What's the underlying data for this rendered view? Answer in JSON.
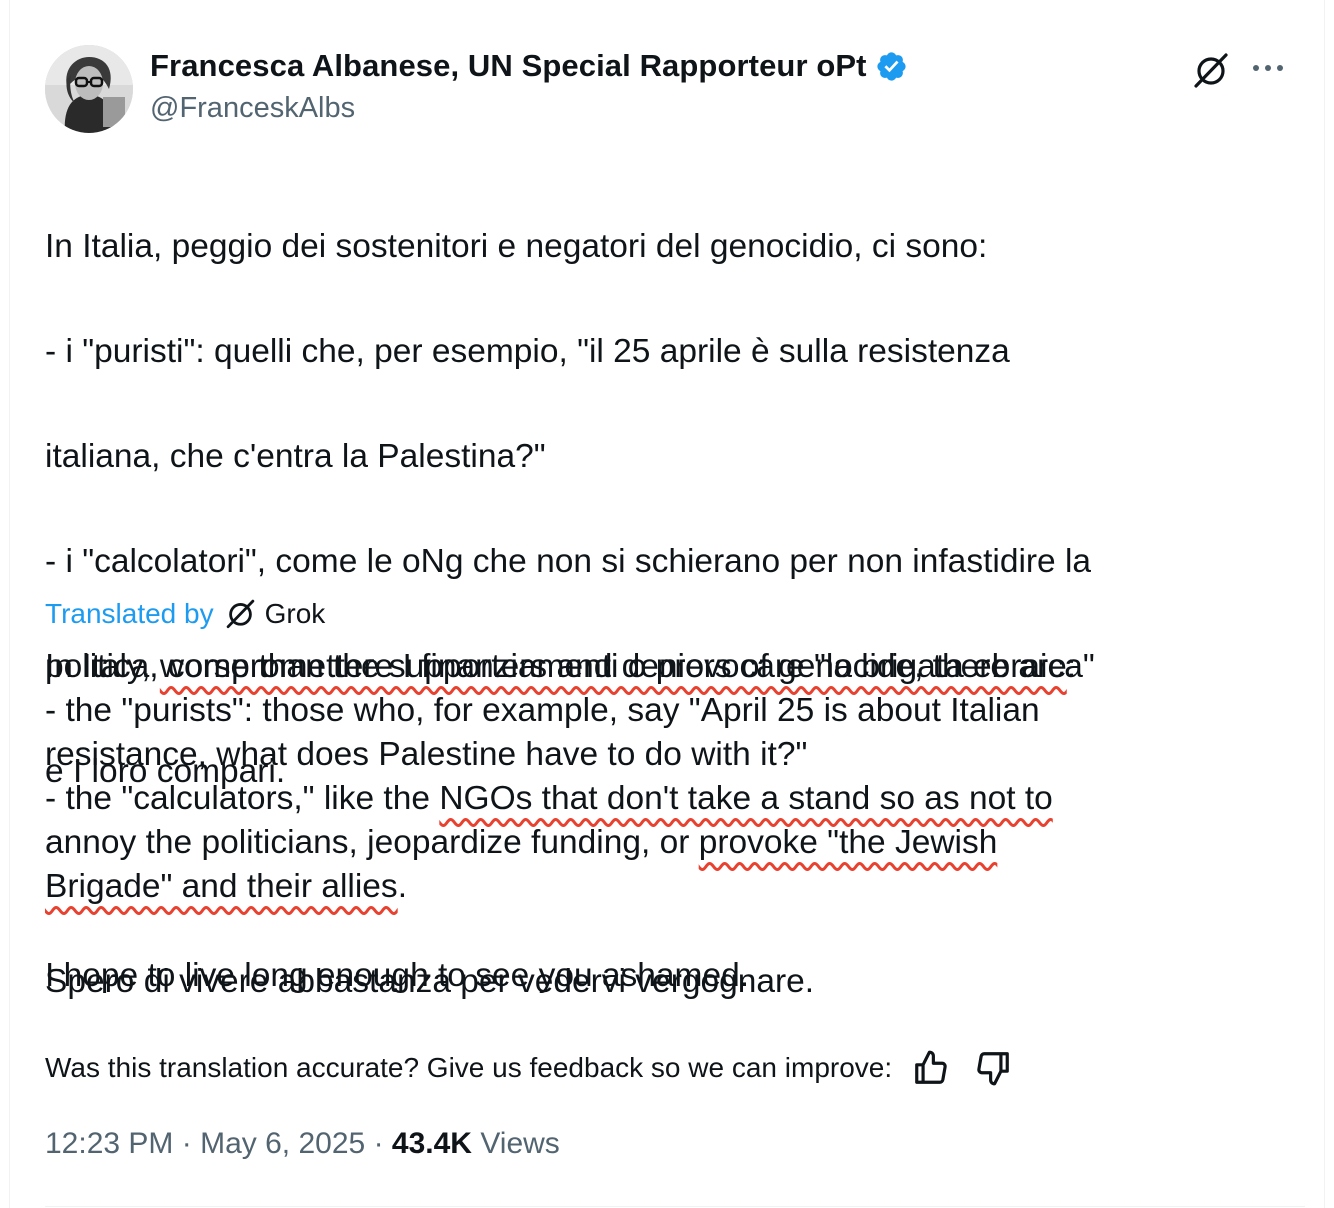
{
  "author": {
    "display_name": "Francesca Albanese, UN Special Rapporteur oPt",
    "handle": "@FranceskAlbs",
    "verified_color": "#1d9bf0"
  },
  "header_icons": {
    "grok": "grok-icon",
    "more": "more-icon"
  },
  "original": {
    "lines": [
      "In Italia, peggio dei sostenitori e negatori del genocidio, ci sono:",
      "- i \"puristi\": quelli che, per esempio, \"il 25 aprile è sulla resistenza",
      "italiana, che c'entra la Palestina?\"",
      "- i \"calcolatori\", come le oNg che non si schierano per non infastidire la",
      "politica, compromettere I finanziamenti o provocare \"la brigata ebraica\"",
      "e I loro compari."
    ],
    "closing": "Spero di vivere abbastanza per vedervi vergognare."
  },
  "translated_by": {
    "label": "Translated by",
    "provider": "Grok",
    "link_color": "#1d9bf0"
  },
  "translation": {
    "p1_a": "In Italy, ",
    "p1_u1": "worse than the supporters and deniers of genocide, there are",
    "p1_b": ":",
    "p2": "- the \"purists\": those who, for example, say \"April 25 is about Italian",
    "p3": "resistance, what does Palestine have to do with it?\"",
    "p4_a": "- the \"calculators,\" like the ",
    "p4_u": "NGOs that don't take a stand so as not to",
    "p5_a": "annoy the politicians, jeopardize funding, or ",
    "p5_u": "provoke \"the Jewish",
    "p6_u": "Brigade\" and their allies",
    "p6_b": ".",
    "closing": "I hope to live long enough to see you ashamed.",
    "underline_color": "#e8412f"
  },
  "feedback": {
    "question": "Was this translation accurate? Give us feedback so we can improve:",
    "thumbs_up": "thumbs-up-icon",
    "thumbs_down": "thumbs-down-icon"
  },
  "meta": {
    "time": "12:23 PM",
    "separator": "·",
    "date": "May 6, 2025",
    "views_count": "43.4K",
    "views_label": "Views"
  }
}
